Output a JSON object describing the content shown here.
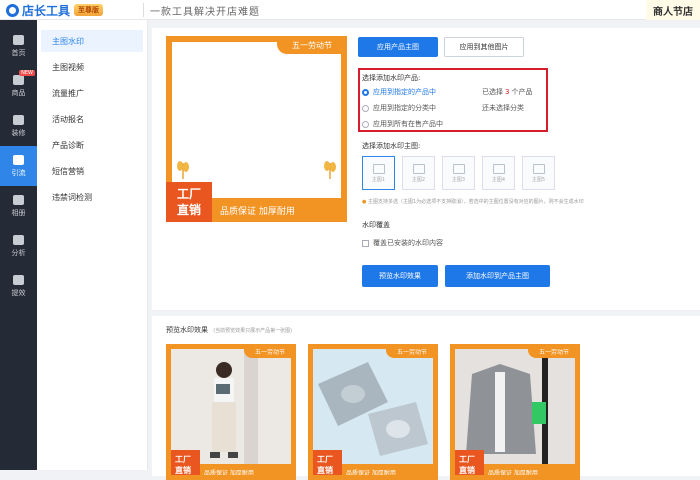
{
  "header": {
    "app_name": "店长工具",
    "badge": "至尊版",
    "slogan": "一款工具解决开店难题",
    "right_text": "商人节店"
  },
  "leftnav": [
    {
      "label": "首页",
      "icon": "home-icon"
    },
    {
      "label": "商品",
      "icon": "product-icon",
      "new": "NEW"
    },
    {
      "label": "装修",
      "icon": "tools-icon"
    },
    {
      "label": "引流",
      "icon": "user-icon"
    },
    {
      "label": "相册",
      "icon": "image-icon"
    },
    {
      "label": "分析",
      "icon": "chart-icon"
    },
    {
      "label": "提效",
      "icon": "rocket-icon"
    }
  ],
  "subnav": [
    "主图水印",
    "主图视频",
    "流量推广",
    "活动报名",
    "产品诊断",
    "短信营销",
    "违禁词检测"
  ],
  "preview": {
    "tag": "五一劳动节",
    "left_line1": "工厂",
    "left_line2": "直销",
    "right": "品质保证 加厚耐用"
  },
  "tabs": {
    "apply_main": "应用产品主图",
    "apply_other": "应用到其他图片"
  },
  "product_select": {
    "label": "选择添加水印产品:",
    "options": [
      {
        "text": "应用到指定的产品中",
        "status_pre": "已选择",
        "status_num": "3",
        "status_post": "个产品"
      },
      {
        "text": "应用到指定的分类中",
        "status_pre": "还未选择分类",
        "status_num": "",
        "status_post": ""
      },
      {
        "text": "应用到所有在售产品中",
        "status_pre": "",
        "status_num": "",
        "status_post": ""
      }
    ]
  },
  "main_image_select": {
    "label": "选择添加水印主图:",
    "thumbs": [
      "主图1",
      "主图2",
      "主图3",
      "主图4",
      "主图5"
    ],
    "hint": "主图支持多选（主图1为必选项不支持取消），若选中的主图位置没有对应的图片，则不会生成水印"
  },
  "overlay": {
    "label": "水印覆盖",
    "checkbox": "覆盖已安装的水印内容"
  },
  "actions": {
    "preview": "预览水印效果",
    "add": "添加水印到产品主图"
  },
  "preview_section": {
    "title": "预览水印效果",
    "note": "(当前预览效果只展示产品第一张图)",
    "cards": [
      {
        "tag": "五一劳动节",
        "left_line1": "工厂",
        "left_line2": "直销",
        "right": "品质保证 加厚耐用"
      },
      {
        "tag": "五一劳动节",
        "left_line1": "工厂",
        "left_line2": "直销",
        "right": "品质保证 加厚耐用"
      },
      {
        "tag": "五一劳动节",
        "left_line1": "工厂",
        "left_line2": "直销",
        "right": "品质保证 加厚耐用"
      }
    ]
  },
  "colors": {
    "primary": "#1f78e8",
    "watermark_orange": "#f29423",
    "watermark_red": "#e9561f",
    "highlight": "#d71c2b",
    "nav_bg": "#252b36"
  }
}
